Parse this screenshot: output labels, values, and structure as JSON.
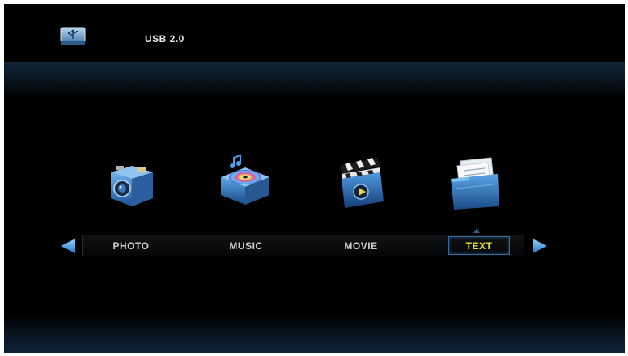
{
  "header": {
    "device_label": "USB 2.0",
    "device_icon": "usb-icon"
  },
  "menu": {
    "items": [
      {
        "label": "PHOTO",
        "icon": "camera-icon"
      },
      {
        "label": "MUSIC",
        "icon": "music-disc-icon"
      },
      {
        "label": "MOVIE",
        "icon": "clapperboard-icon"
      },
      {
        "label": "TEXT",
        "icon": "document-folder-icon"
      }
    ],
    "selected_index": 3
  },
  "colors": {
    "accent_blue": "#3a8fd6",
    "selected_text": "#e8e03a",
    "normal_text": "#cfcfcf"
  }
}
